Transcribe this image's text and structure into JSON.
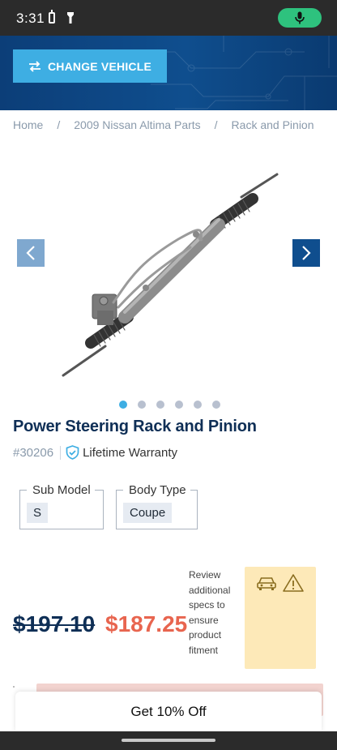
{
  "status": {
    "time": "3:31"
  },
  "hero": {
    "change_vehicle_label": "CHANGE VEHICLE"
  },
  "breadcrumb": {
    "items": [
      "Home",
      "2009 Nissan Altima Parts",
      "Rack and Pinion"
    ],
    "separator": "/"
  },
  "gallery": {
    "total_slides": 6,
    "active_slide": 1
  },
  "product": {
    "title": "Power Steering Rack and Pinion",
    "sku": "#30206",
    "warranty": "Lifetime Warranty"
  },
  "specs": [
    {
      "label": "Sub Model",
      "value": "S"
    },
    {
      "label": "Body Type",
      "value": "Coupe"
    }
  ],
  "pricing": {
    "original": "$197.10",
    "sale": "$187.25",
    "note": "Review additional specs to ensure product fitment"
  },
  "promo": {
    "label": "Get 10% Off"
  },
  "colors": {
    "brand_navy": "#0f2f56",
    "accent_blue": "#3eaee3",
    "sale_red": "#e8654f",
    "notice_yellow": "#fde9b8"
  },
  "icons": {
    "status": [
      "battery-icon",
      "flashlight-icon",
      "microphone-icon"
    ],
    "hero": "swap-arrows-icon",
    "gallery": [
      "chevron-left-icon",
      "chevron-right-icon"
    ],
    "product": "shield-check-icon",
    "fitment": [
      "car-icon",
      "warning-icon"
    ]
  }
}
